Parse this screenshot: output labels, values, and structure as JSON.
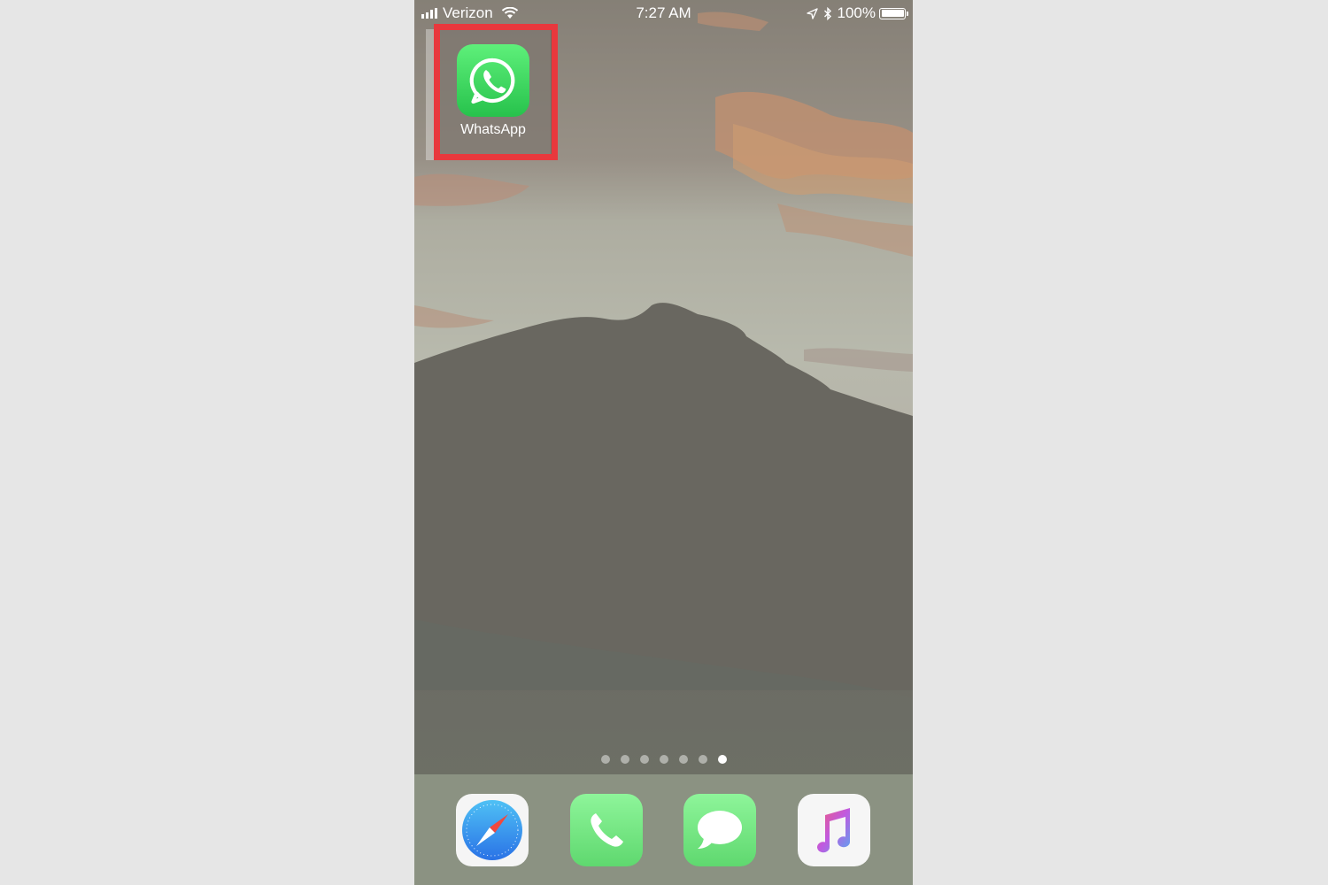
{
  "status_bar": {
    "carrier": "Verizon",
    "time": "7:27 AM",
    "battery_percent": "100%",
    "signal_bars": 4,
    "icons": [
      "signal-icon",
      "wifi-icon",
      "location-icon",
      "bluetooth-icon",
      "battery-icon"
    ]
  },
  "home_screen": {
    "apps": [
      {
        "label": "WhatsApp",
        "icon": "whatsapp-icon",
        "highlighted": true,
        "highlight_color": "#e8383d"
      }
    ],
    "page_indicator": {
      "count": 7,
      "active_index": 6
    }
  },
  "dock": {
    "apps": [
      {
        "name": "Safari",
        "icon": "safari-icon"
      },
      {
        "name": "Phone",
        "icon": "phone-icon"
      },
      {
        "name": "Messages",
        "icon": "messages-icon"
      },
      {
        "name": "Music",
        "icon": "music-icon"
      }
    ]
  },
  "colors": {
    "page_background": "#e6e6e6",
    "highlight_box": "#e8383d",
    "whatsapp_green": "#27c24c"
  }
}
